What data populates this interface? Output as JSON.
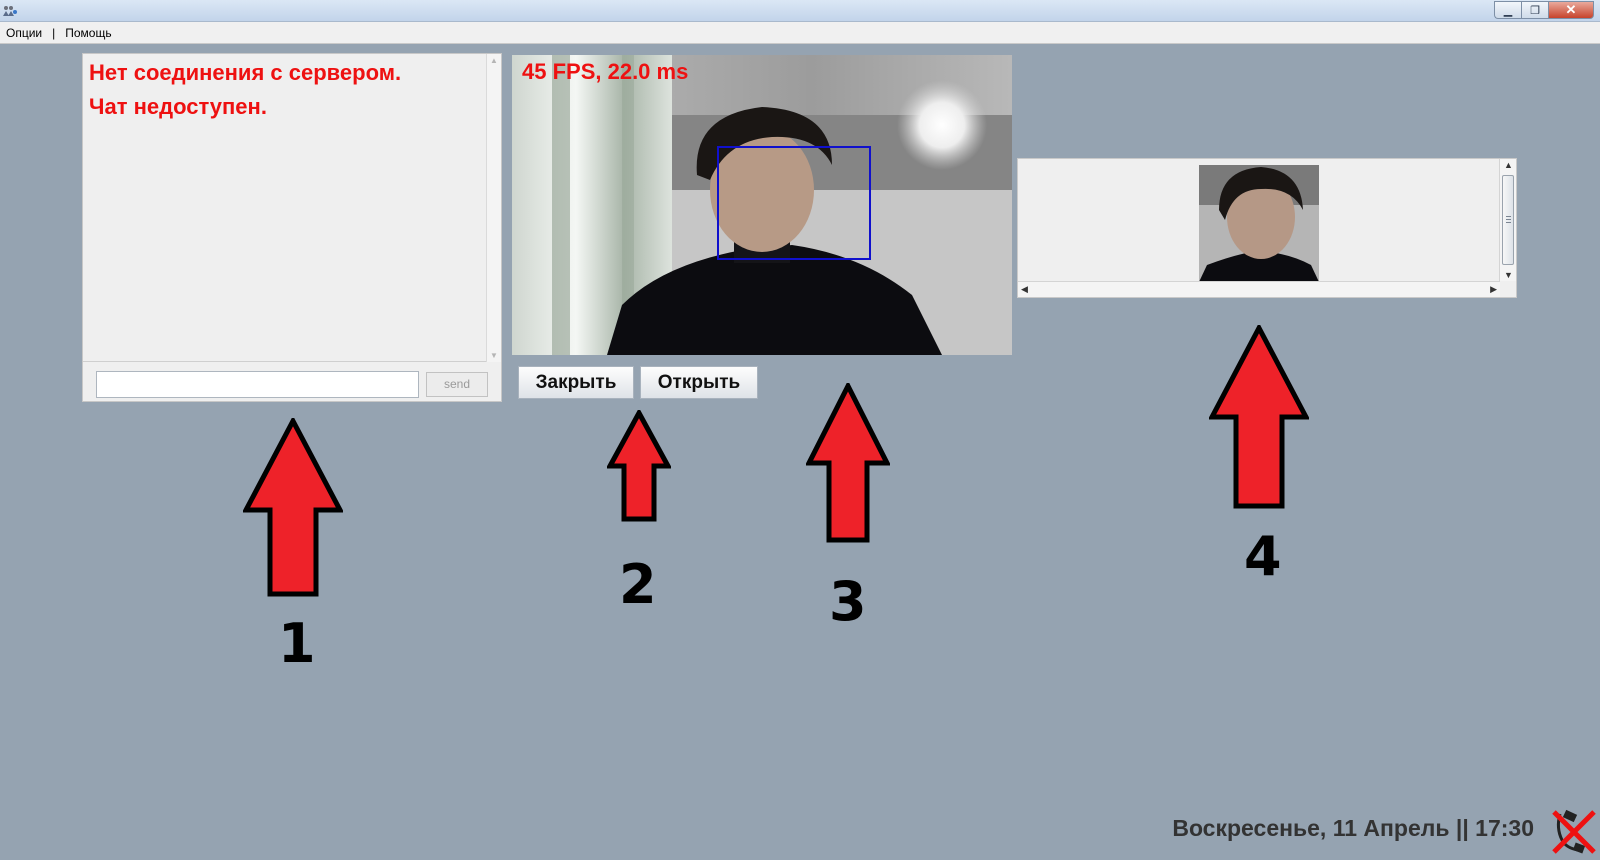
{
  "menu": {
    "options": "Опции",
    "separator": "|",
    "help": "Помощь"
  },
  "window_controls": {
    "minimize": "▁",
    "restore": "❐",
    "close": "✕"
  },
  "chat": {
    "lines": [
      "Нет соединения с сервером.",
      "Чат недоступен."
    ],
    "input_value": "",
    "send_label": "send"
  },
  "camera": {
    "fps_label": "45 FPS, 22.0 ms"
  },
  "buttons": {
    "close_label": "Закрыть",
    "open_label": "Открыть"
  },
  "annotations": [
    "1",
    "2",
    "3",
    "4"
  ],
  "status": {
    "date": "Воскресенье, 11 Апрель",
    "separator": " || ",
    "time": "17:30"
  },
  "colors": {
    "background": "#95a3b1",
    "alert_red": "#ee1111",
    "arrow_red": "#ee2229",
    "face_box": "#1010cc"
  },
  "icons": [
    "app-icon",
    "minimize-icon",
    "restore-icon",
    "close-icon",
    "no-connection-icon"
  ]
}
